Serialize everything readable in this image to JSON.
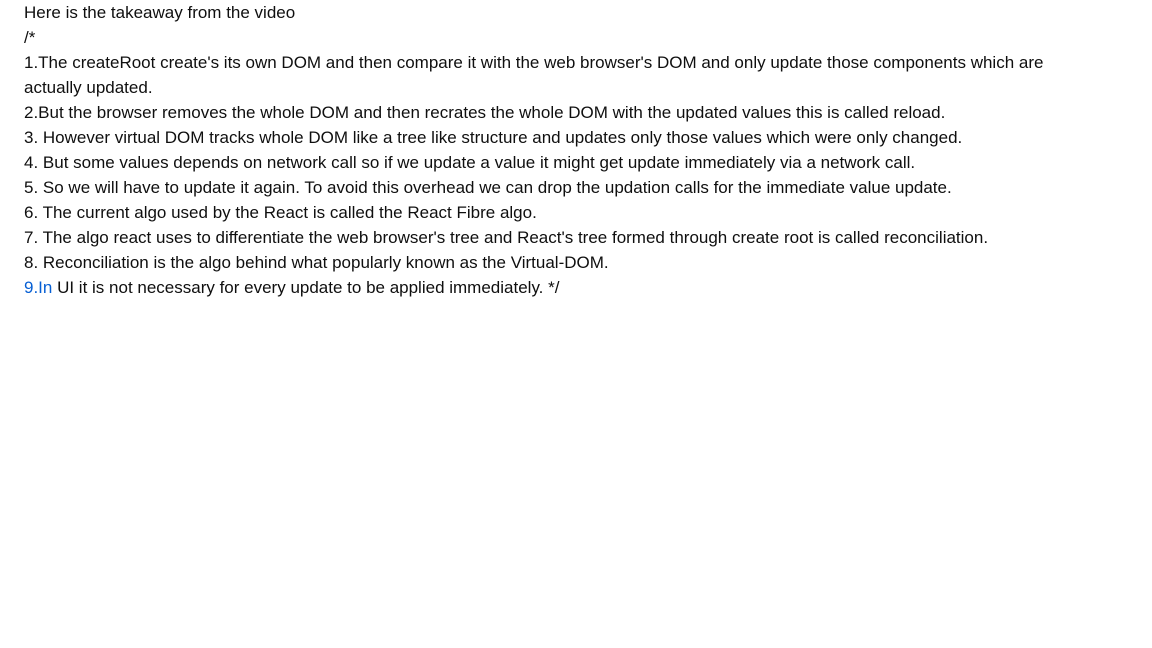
{
  "comment": {
    "intro": "Here is the takeaway from the video",
    "open_marker": "/*",
    "items": [
      "1.The createRoot create's its own DOM and then compare it with the web browser's DOM and only update those components which are actually updated.",
      "2.But the browser removes the whole DOM and then recrates the whole DOM with the updated values this is called reload.",
      "3. However virtual DOM tracks whole DOM like a tree like structure and updates only those values which were only changed.",
      "4. But some values depends on network call so if we update a value it might get update immediately via a network call.",
      "5. So we will have to update it again. To avoid this overhead we can drop the updation calls for the immediate value update.",
      "6. The current algo used by the React is called the React Fibre algo.",
      "7. The algo react uses to differentiate the web browser's tree and React's tree formed through create root is called reconciliation.",
      "8. Reconciliation is the algo behind what popularly known as the Virtual-DOM."
    ],
    "last_item": {
      "link_text": "9.In",
      "rest_text": " UI it is not necessary for every update to be applied immediately. */"
    },
    "link_color": "#065fd4"
  }
}
